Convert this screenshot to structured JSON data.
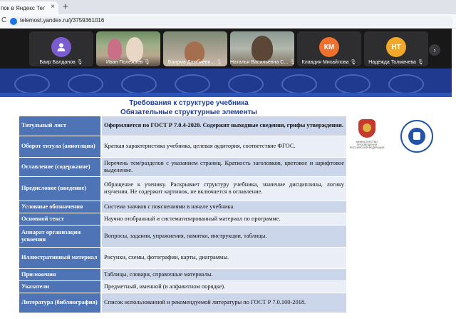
{
  "browser": {
    "tab_title": "пок в Яндекс Телемост",
    "tab_close": "×",
    "new_tab": "+",
    "reload": "C",
    "url": "telemost.yandex.ru/j/3759361016"
  },
  "participants": [
    {
      "name": "Баир Балданов",
      "initials": "",
      "avatar_color": "#7b5ccf",
      "type": "icon"
    },
    {
      "name": "Иван Полежаев",
      "initials": "",
      "type": "video"
    },
    {
      "name": "Баирма Дамбиевн...",
      "initials": "",
      "type": "video"
    },
    {
      "name": "Наталья Васильевна С...",
      "initials": "",
      "type": "video"
    },
    {
      "name": "Клавдия Михайлова",
      "initials": "КМ",
      "avatar_color": "#f0702e",
      "type": "initials"
    },
    {
      "name": "Надежда Толмачева",
      "initials": "НТ",
      "avatar_color": "#f2a92a",
      "type": "initials"
    }
  ],
  "mic_glyph": "🎙",
  "strip_next": "›",
  "slide": {
    "title": "Требования к структуре учебника",
    "subtitle": "Обязательные структурные элементы",
    "ministry_caption": "Министерство просвещения Российской Федерации",
    "rows": [
      {
        "term": "Титульный лист",
        "desc": "Оформляется по ГОСТ Р 7.0.4-2020. Содержит выходные сведения, грифы утверждения."
      },
      {
        "term": "Оборот титула (аннотация)",
        "desc": "Краткая характеристика учебника, целевая аудитория, соответствие ФГОС."
      },
      {
        "term": "Оглавление (содержание)",
        "desc": "Перечень тем/разделов с указанием страниц. Краткость заголовков, цветовое и шрифтовое выделение."
      },
      {
        "term": "Предисловие (введение)",
        "desc": "Обращение к ученику. Раскрывает структуру учебника, значение дисциплины, логику изучения. Не содержит картинок, не включается в оглавление."
      },
      {
        "term": "Условные обозначения",
        "desc": "Система значков с пояснениями в начале учебника."
      },
      {
        "term": "Основной текст",
        "desc": "Научно отобранный и систематизированный материал по программе."
      },
      {
        "term": "Аппарат организации усвоения",
        "desc": "Вопросы, задания, упражнения, памятки, инструкции, таблицы."
      },
      {
        "term": "Иллюстративный материал",
        "desc": "Рисунки, схемы, фотографии, карты, диаграммы."
      },
      {
        "term": "Приложения",
        "desc": "Таблицы, словари, справочные материалы."
      },
      {
        "term": "Указатели",
        "desc": "Предметный, именной (в алфавитном порядке)."
      },
      {
        "term": "Литература (библиография)",
        "desc": "Список использованной и рекомендуемой литературы по ГОСТ Р 7.0.100-2018."
      }
    ]
  }
}
